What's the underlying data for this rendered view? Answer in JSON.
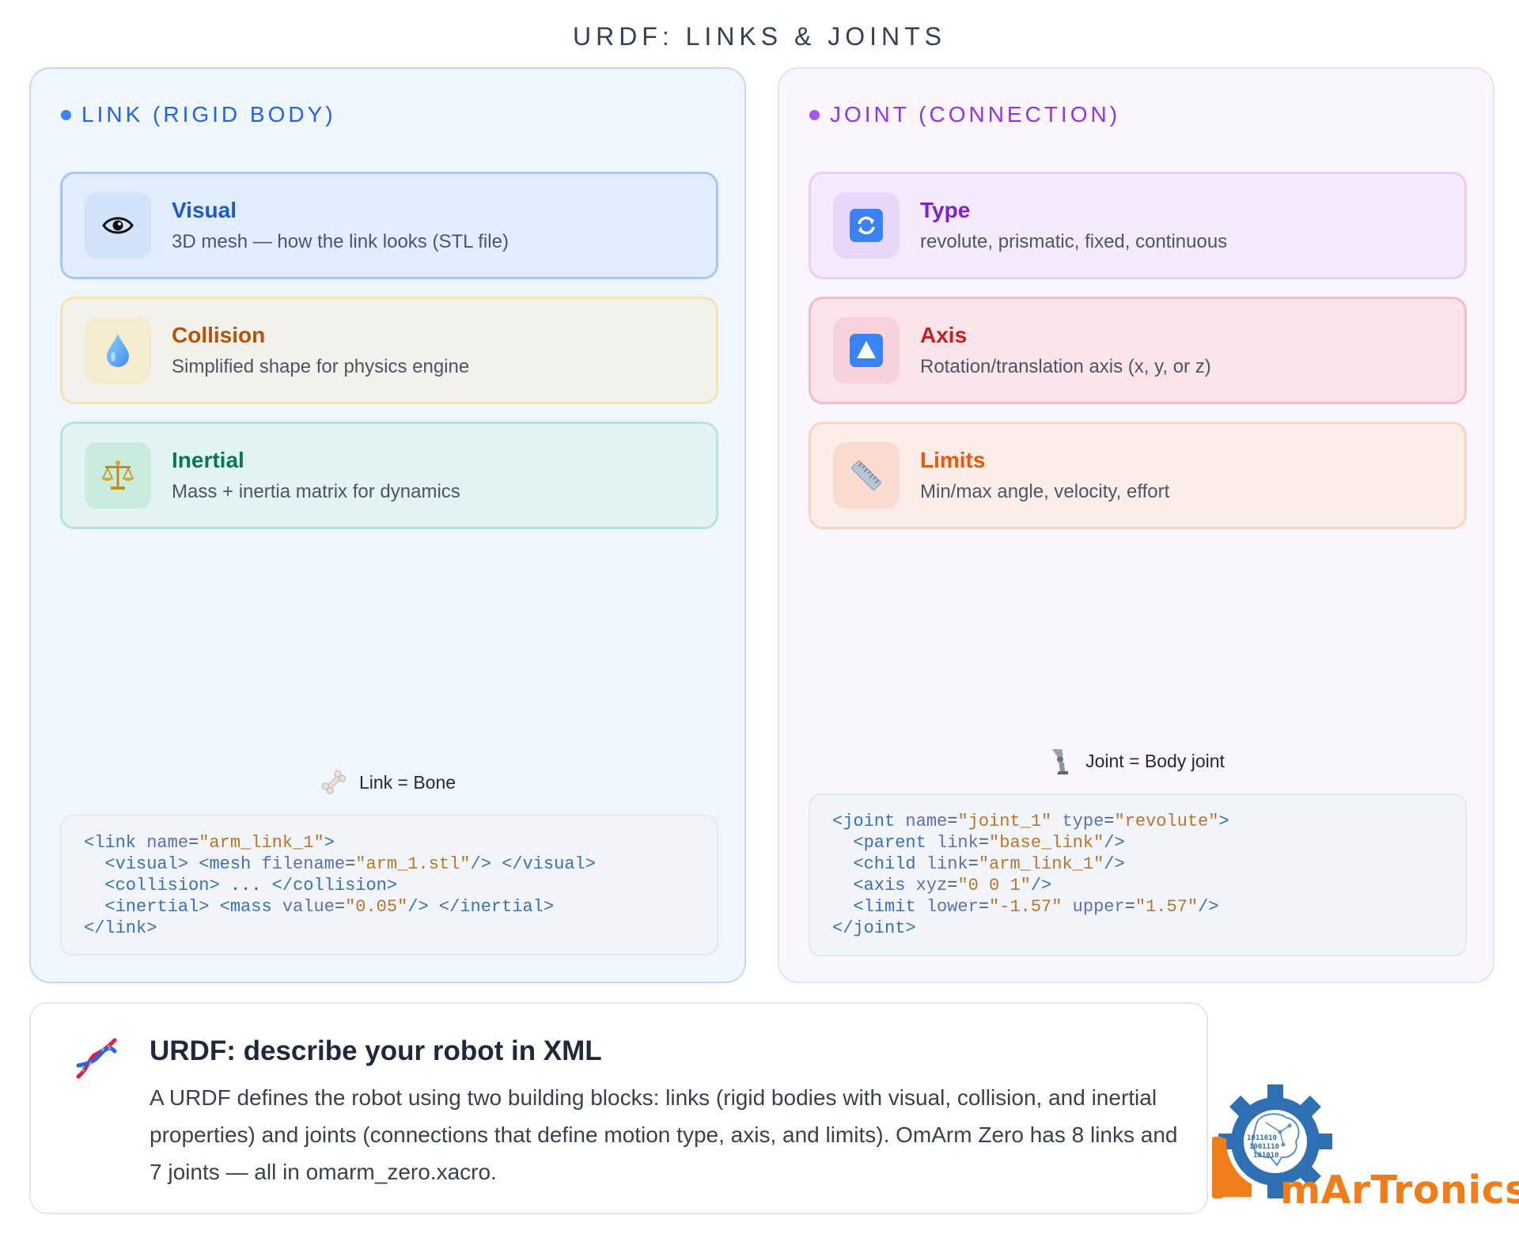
{
  "title": "URDF: LINKS & JOINTS",
  "link_panel": {
    "header": "LINK (RIGID BODY)",
    "cards": [
      {
        "title": "Visual",
        "desc": "3D mesh — how the link looks (STL file)",
        "icon": "eye-icon"
      },
      {
        "title": "Collision",
        "desc": "Simplified shape for physics engine",
        "icon": "droplet-icon"
      },
      {
        "title": "Inertial",
        "desc": "Mass + inertia matrix for dynamics",
        "icon": "balance-scale-icon"
      }
    ],
    "analogy": "Link = Bone",
    "analogy_icon": "bone-icon",
    "code": {
      "link_open": "link",
      "name_attr": "name",
      "name_val": "\"arm_link_1\"",
      "visual": "visual",
      "mesh": "mesh",
      "filename_attr": "filename",
      "filename_val": "\"arm_1.stl\"",
      "collision": "collision",
      "ellipsis": "...",
      "inertial": "inertial",
      "mass": "mass",
      "value_attr": "value",
      "value_val": "\"0.05\""
    }
  },
  "joint_panel": {
    "header": "JOINT (CONNECTION)",
    "cards": [
      {
        "title": "Type",
        "desc": "revolute, prismatic, fixed, continuous",
        "icon": "refresh-icon"
      },
      {
        "title": "Axis",
        "desc": "Rotation/translation axis (x, y, or z)",
        "icon": "up-triangle-icon"
      },
      {
        "title": "Limits",
        "desc": "Min/max angle, velocity, effort",
        "icon": "ruler-icon"
      }
    ],
    "analogy": "Joint = Body joint",
    "analogy_icon": "robot-leg-icon",
    "code": {
      "joint": "joint",
      "name_attr": "name",
      "name_val": "\"joint_1\"",
      "type_attr": "type",
      "type_val": "\"revolute\"",
      "parent": "parent",
      "link_attr": "link",
      "parent_val": "\"base_link\"",
      "child": "child",
      "child_val": "\"arm_link_1\"",
      "axis": "axis",
      "xyz_attr": "xyz",
      "xyz_val": "\"0 0 1\"",
      "limit": "limit",
      "lower_attr": "lower",
      "lower_val": "\"-1.57\"",
      "upper_attr": "upper",
      "upper_val": "\"1.57\""
    }
  },
  "summary": {
    "title": "URDF: describe your robot in XML",
    "body": "A URDF defines the robot using two building blocks: links (rigid bodies with visual, collision, and inertial properties) and joints (connections that define motion type, axis, and limits). OmArm Zero has 8 links and 7 joints — all in omarm_zero.xacro.",
    "icon": "dna-icon"
  },
  "brand": {
    "name": "mArTronics",
    "logo_binary": [
      "1011010",
      "1001110",
      "101010"
    ],
    "icon": "gear-brain-logo-icon"
  }
}
